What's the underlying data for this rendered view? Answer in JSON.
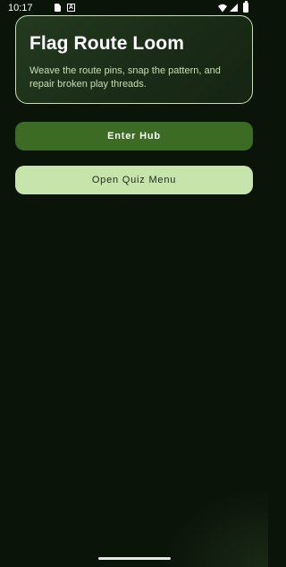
{
  "status_bar": {
    "time": "10:17",
    "a_badge": "A",
    "icons": [
      "sd-card-icon",
      "a-badge-icon",
      "wifi-icon",
      "signal-icon",
      "battery-icon"
    ]
  },
  "hero": {
    "title": "Flag Route Loom",
    "subtitle": "Weave the route pins, snap the pattern, and repair broken play threads."
  },
  "actions": {
    "enter_hub_label": "Enter Hub",
    "open_quiz_menu_label": "Open Quiz Menu"
  },
  "colors": {
    "background": "#0a1409",
    "card_border": "#c8dfb6",
    "primary_button": "#3c6b24",
    "secondary_button": "#c8e4ad",
    "subtitle_text": "#c8dfb6"
  }
}
